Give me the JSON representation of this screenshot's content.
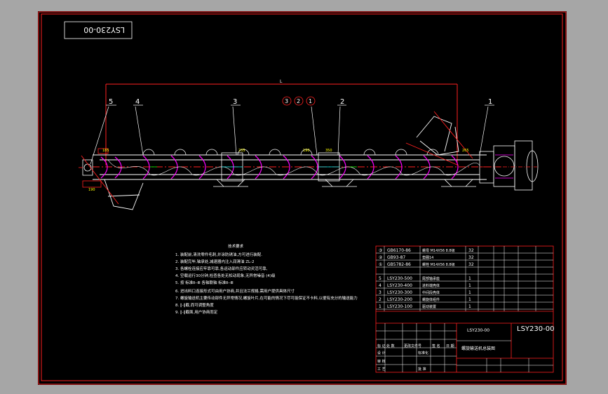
{
  "drawing_code": "LSY230-00",
  "title_block": {
    "code": "LSY230-00",
    "drawing_number": "LSY230-00",
    "name": "螺旋输送机总装图",
    "header_labels": [
      "标 记",
      "处 数",
      "更改文件号",
      "签 名",
      "日 期"
    ],
    "left_labels": [
      "设 计",
      "审 核",
      "工 艺"
    ],
    "extra_labels": [
      "标准化",
      "批 准"
    ]
  },
  "balloons": {
    "top": [
      "5",
      "4",
      "3",
      "③",
      "②",
      "①",
      "2",
      "1"
    ],
    "item_labels": [
      {
        "id": "5",
        "text": "5"
      },
      {
        "id": "4",
        "text": "4"
      },
      {
        "id": "3",
        "text": "3"
      },
      {
        "id": "c3",
        "text": "3"
      },
      {
        "id": "c2",
        "text": "2"
      },
      {
        "id": "c1",
        "text": "1"
      },
      {
        "id": "2",
        "text": "2"
      },
      {
        "id": "1",
        "text": "1"
      }
    ]
  },
  "tech_notes": {
    "title": "技术要求",
    "lines": [
      "1. 装配前,清洗零件毛刺,并涂防锈油,方可进行装配.",
      "2. 装配完毕,轴承处,减速器内注入润滑油 ZL-2",
      "3. 各螺栓连接应牢靠可靠,各运动部件应转动灵活可靠,",
      "4. 空载运行30分钟,检查各处无松动现象,无异常噪音 (4)级",
      "5. 按 标准Ⅱ--Ⅲ 各轴联轴 标准Ⅱ--Ⅲ",
      "6. 进出料口连接形式可由用户协商,并且法兰规格,需用户提供具体尺寸",
      "7. 螺旋输送机主要传动部件无异常情况,螺旋叶片,在可能的情况下尽可能保证不卡料,以便有充分的输送能力",
      "8. ∥-∥截,而可调整角度",
      "9. ∥-∥截面,用户协商而定"
    ]
  },
  "parts_list": [
    {
      "no": "③",
      "code": "GB6170-86",
      "name": "螺母 M14X56 8.8级",
      "qty": "32"
    },
    {
      "no": "②",
      "code": "GB93-87",
      "name": "垫圈14",
      "qty": "32"
    },
    {
      "no": "①",
      "code": "GB5782-86",
      "name": "螺栓 M14X56 8.8级",
      "qty": "32"
    },
    {
      "no": "5",
      "code": "LSY230-500",
      "name": "尾部轴承座",
      "qty": "1"
    },
    {
      "no": "4",
      "code": "LSY230-400",
      "name": "进料端壳体",
      "qty": "1"
    },
    {
      "no": "3",
      "code": "LSY230-300",
      "name": "中间段壳体",
      "qty": "1"
    },
    {
      "no": "2",
      "code": "LSY230-200",
      "name": "螺旋体组件",
      "qty": "1"
    },
    {
      "no": "1",
      "code": "LSY230-100",
      "name": "驱动装置",
      "qty": "1"
    }
  ],
  "dimensions": {
    "overall_label": "L",
    "small_labels": [
      "185",
      "190",
      "190",
      "235",
      "265",
      "350"
    ]
  },
  "colors": {
    "background": "#000000",
    "frame": "#ff2020",
    "line": "#ffffff",
    "accent": "#ff00ff",
    "cyan": "#00ffff",
    "yellow": "#ffff00",
    "green": "#00ff00"
  }
}
